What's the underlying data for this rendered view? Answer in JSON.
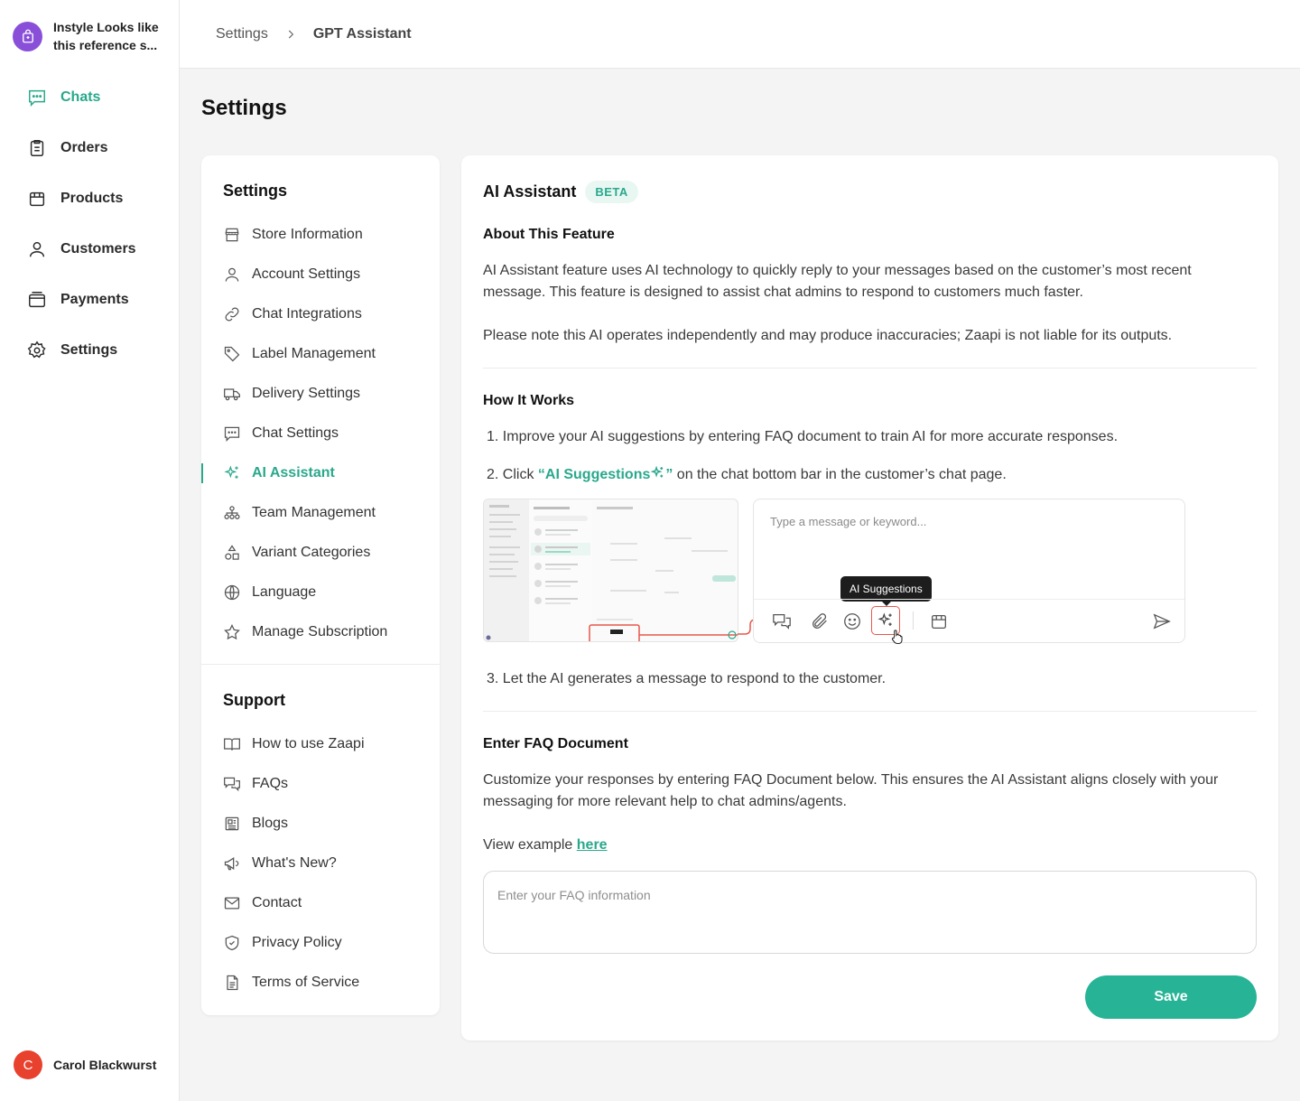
{
  "store": {
    "name": "Instyle Looks like this reference s..."
  },
  "nav": [
    {
      "label": "Chats",
      "icon": "chat-icon",
      "active": true
    },
    {
      "label": "Orders",
      "icon": "clipboard-icon"
    },
    {
      "label": "Products",
      "icon": "box-icon"
    },
    {
      "label": "Customers",
      "icon": "user-icon"
    },
    {
      "label": "Payments",
      "icon": "wallet-icon"
    },
    {
      "label": "Settings",
      "icon": "gear-icon"
    }
  ],
  "user": {
    "initial": "C",
    "name": "Carol Blackwurst"
  },
  "breadcrumb": {
    "parent": "Settings",
    "current": "GPT Assistant"
  },
  "page_title": "Settings",
  "settings_menu": {
    "heading": "Settings",
    "items": [
      {
        "label": "Store Information",
        "icon": "store-icon"
      },
      {
        "label": "Account Settings",
        "icon": "user-icon"
      },
      {
        "label": "Chat Integrations",
        "icon": "link-icon"
      },
      {
        "label": "Label Management",
        "icon": "tag-icon"
      },
      {
        "label": "Delivery Settings",
        "icon": "truck-icon"
      },
      {
        "label": "Chat Settings",
        "icon": "chat-icon"
      },
      {
        "label": "AI Assistant",
        "icon": "sparkle-icon",
        "active": true
      },
      {
        "label": "Team Management",
        "icon": "team-icon"
      },
      {
        "label": "Variant Categories",
        "icon": "shapes-icon"
      },
      {
        "label": "Language",
        "icon": "globe-icon"
      },
      {
        "label": "Manage Subscription",
        "icon": "star-icon"
      }
    ]
  },
  "support_menu": {
    "heading": "Support",
    "items": [
      {
        "label": "How to use Zaapi",
        "icon": "book-icon"
      },
      {
        "label": "FAQs",
        "icon": "faq-icon"
      },
      {
        "label": "Blogs",
        "icon": "newspaper-icon"
      },
      {
        "label": "What's New?",
        "icon": "megaphone-icon"
      },
      {
        "label": "Contact",
        "icon": "mail-icon"
      },
      {
        "label": "Privacy Policy",
        "icon": "shield-icon"
      },
      {
        "label": "Terms of Service",
        "icon": "document-icon"
      }
    ]
  },
  "content": {
    "title": "AI Assistant",
    "badge": "BETA",
    "about": {
      "heading": "About This Feature",
      "p1": "AI Assistant feature uses AI technology to quickly reply to your messages based on the customer’s most recent message. This feature is designed to assist chat admins to respond to customers much faster.",
      "p2": "Please note this AI operates independently and may produce inaccuracies; Zaapi is not liable for its outputs."
    },
    "how": {
      "heading": "How It Works",
      "step1": "1. Improve your AI suggestions by entering FAQ document to train AI for more accurate responses.",
      "step2_prefix": "2. Click ",
      "step2_highlight": "“AI Suggestions",
      "step2_quote_end": "”",
      "step2_suffix": " on the chat bottom bar in the customer’s chat page.",
      "step3": "3. Let the AI generates a message to respond to the customer.",
      "demo_placeholder": "Type a message or keyword...",
      "demo_tooltip": "AI Suggestions"
    },
    "faq": {
      "heading": "Enter FAQ Document",
      "description": "Customize your responses by entering FAQ Document below. This ensures the AI Assistant aligns closely with your messaging for more relevant help to chat admins/agents.",
      "example_prefix": "View example ",
      "example_link": "here",
      "placeholder": "Enter your FAQ information"
    },
    "save_label": "Save"
  },
  "colors": {
    "accent": "#2aa88c",
    "button": "#27b396",
    "avatar": "#e8412e",
    "store_logo": "#8a4fd8",
    "highlight_red": "#e8574a"
  }
}
